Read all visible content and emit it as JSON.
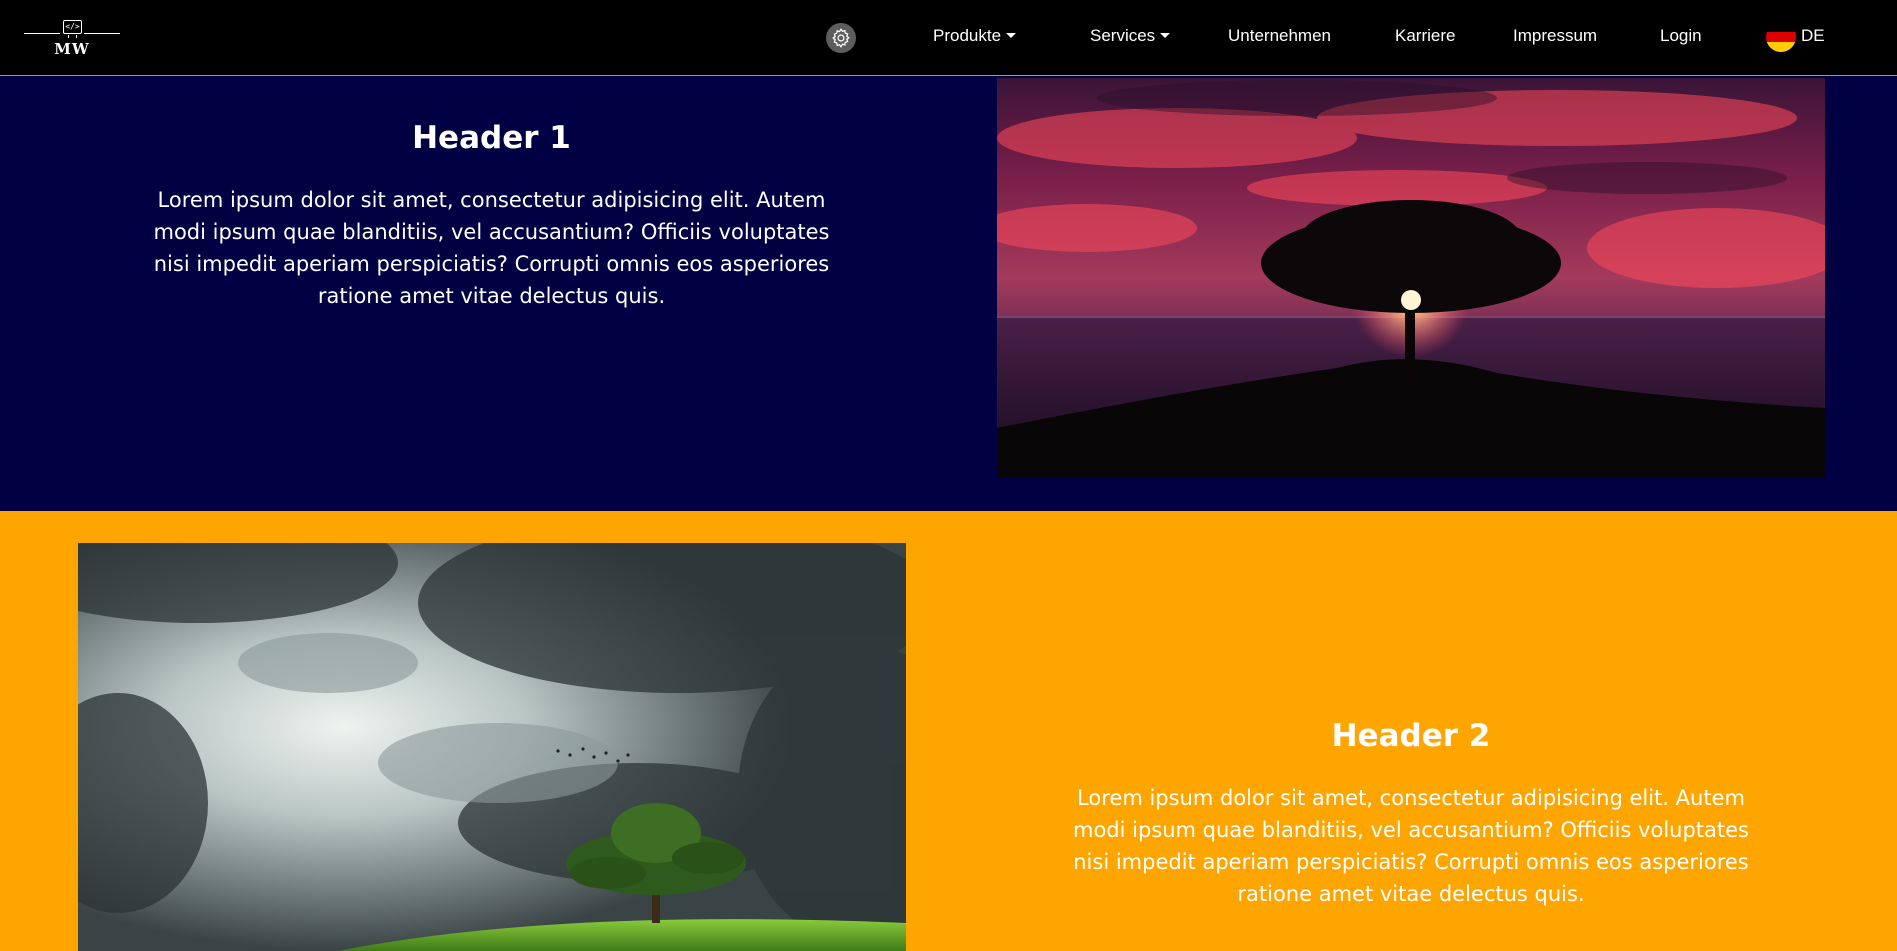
{
  "brand": {
    "logo_text": "MW",
    "logo_code": "</>"
  },
  "nav": {
    "items": [
      {
        "label": "Produkte",
        "dropdown": true
      },
      {
        "label": "Services",
        "dropdown": true
      },
      {
        "label": "Unternehmen",
        "dropdown": false
      },
      {
        "label": "Karriere",
        "dropdown": false
      },
      {
        "label": "Impressum",
        "dropdown": false
      },
      {
        "label": "Login",
        "dropdown": false
      }
    ],
    "settings_icon": "gear-icon",
    "language": {
      "code": "DE",
      "flag_icon": "germany-flag-icon"
    }
  },
  "sections": [
    {
      "header": "Header 1",
      "body": "Lorem ipsum dolor sit amet, consectetur adipisicing elit. Autem modi ipsum quae blanditiis, vel accusantium? Officiis voluptates nisi impedit aperiam perspiciatis? Corrupti omnis eos asperiores ratione amet vitae delectus quis.",
      "background": "#000042",
      "image": "sunset-tree-image"
    },
    {
      "header": "Header 2",
      "body": "Lorem ipsum dolor sit amet, consectetur adipisicing elit. Autem modi ipsum quae blanditiis, vel accusantium? Officiis voluptates nisi impedit aperiam perspiciatis? Corrupti omnis eos asperiores ratione amet vitae delectus quis.",
      "background": "#ffa500",
      "image": "storm-tree-image"
    }
  ]
}
